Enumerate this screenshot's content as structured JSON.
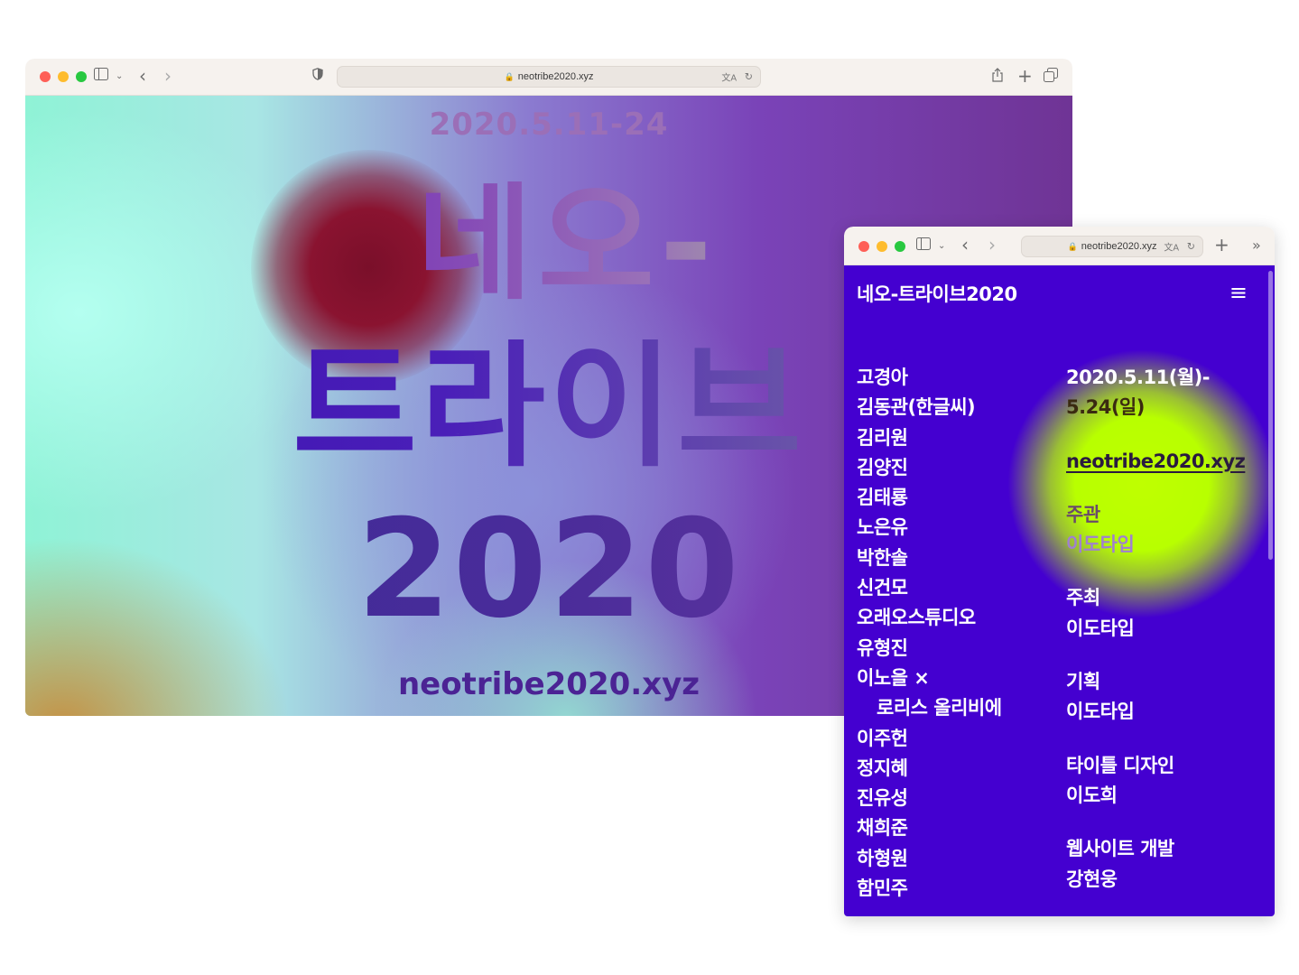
{
  "window_main": {
    "address": "neotribe2020.xyz",
    "poster": {
      "date": "2020.5.11-24",
      "title_line1": "네오-",
      "title_line2": "트라이브",
      "title_line3": "2020",
      "url": "neotribe2020.xyz"
    }
  },
  "window_mobile": {
    "address": "neotribe2020.xyz",
    "site_title": "네오-트라이브2020",
    "menu_icon": "≡",
    "artists": [
      "고경아",
      "김동관(한글씨)",
      "김리원",
      "김양진",
      "김태룡",
      "노은유",
      "박한솔",
      "신건모",
      "오래오스튜디오",
      "유형진",
      "이노을 ×",
      "로리스 올리비에",
      "이주헌",
      "정지혜",
      "진유성",
      "채희준",
      "하형원",
      "함민주"
    ],
    "info": {
      "date_line1": "2020.5.11(월)-",
      "date_line2": "5.24(일)",
      "link": "neotribe2020.xyz",
      "credits": [
        {
          "role": "주관",
          "name": "이도타입"
        },
        {
          "role": "주최",
          "name": "이도타입"
        },
        {
          "role": "기획",
          "name": "이도타입"
        },
        {
          "role": "타이틀 디자인",
          "name": "이도희"
        },
        {
          "role": "웹사이트 개발",
          "name": "강현웅"
        }
      ]
    }
  },
  "colors": {
    "mobile_bg": "#4400d0",
    "glow": "#b8ff00",
    "chrome_bg": "#f6f2ee"
  }
}
